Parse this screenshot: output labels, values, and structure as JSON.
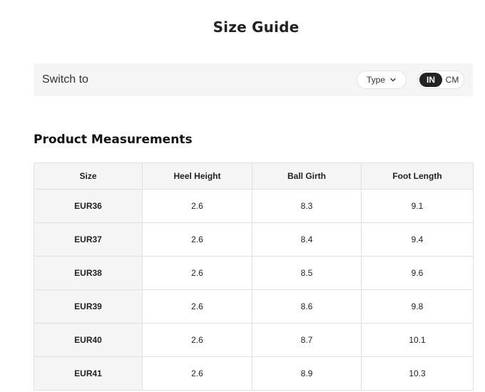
{
  "page": {
    "title": "Size Guide"
  },
  "switch_bar": {
    "label": "Switch to",
    "type_dropdown": {
      "label": "Type",
      "icon": "chevron-down-icon"
    },
    "unit_toggle": {
      "options": [
        "IN",
        "CM"
      ],
      "selected": "IN",
      "active_color": "#222222"
    }
  },
  "measurements": {
    "title": "Product Measurements",
    "columns": [
      "Size",
      "Heel Height",
      "Ball Girth",
      "Foot Length"
    ],
    "rows": [
      [
        "EUR36",
        "2.6",
        "8.3",
        "9.1"
      ],
      [
        "EUR37",
        "2.6",
        "8.4",
        "9.4"
      ],
      [
        "EUR38",
        "2.6",
        "8.5",
        "9.6"
      ],
      [
        "EUR39",
        "2.6",
        "8.6",
        "9.8"
      ],
      [
        "EUR40",
        "2.6",
        "8.7",
        "10.1"
      ],
      [
        "EUR41",
        "2.6",
        "8.9",
        "10.3"
      ]
    ]
  }
}
